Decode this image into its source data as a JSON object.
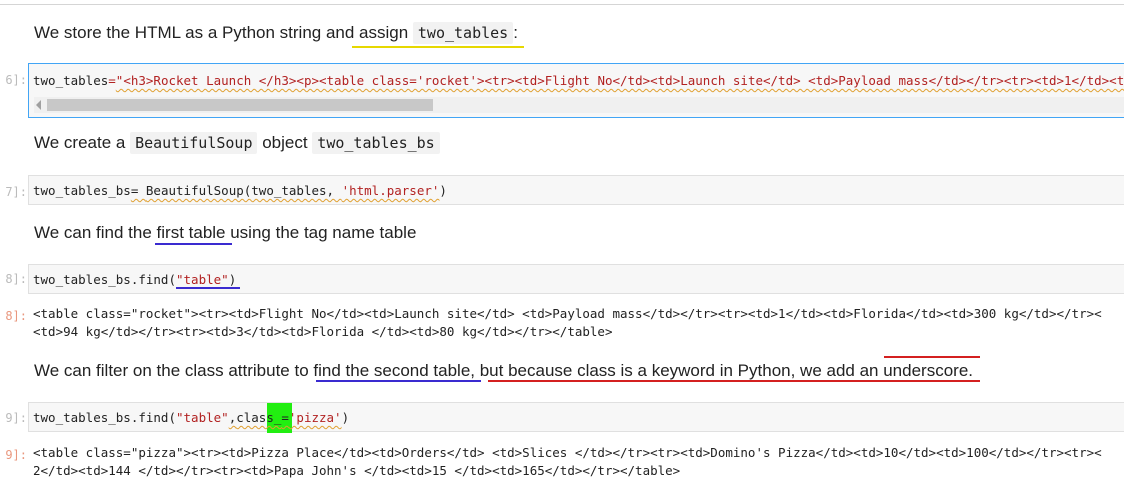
{
  "md1": {
    "text": "We store the HTML as a Python string and assign ",
    "code": "two_tables",
    "tail": ":"
  },
  "cell1": {
    "prompt": "6]:",
    "var": "two_tables",
    "eq": "=",
    "string": "\"<h3>Rocket Launch </h3><p><table class='rocket'><tr><td>Flight No</td><td>Launch site</td> <td>Payload mass</td></tr><tr><td>1</td><t"
  },
  "md2": {
    "pre": "We create a ",
    "code1": "BeautifulSoup",
    "mid": " object ",
    "code2": "two_tables_bs"
  },
  "cell2": {
    "prompt": "7]:",
    "pre": "two_tables_bs",
    "eq": "= ",
    "call": "BeautifulSoup(two_tables, ",
    "str": "'html.parser'",
    "close": ")"
  },
  "md3": {
    "text": "We can find the first table using the tag name table"
  },
  "cell3": {
    "prompt": "8]:",
    "pre": "two_tables_bs.find(",
    "str": "\"table\"",
    "close": ")"
  },
  "out3": {
    "prompt": "8]:",
    "line1": "<table class=\"rocket\"><tr><td>Flight No</td><td>Launch site</td> <td>Payload mass</td></tr><tr><td>1</td><td>Florida</td><td>300 kg</td></tr><",
    "line2": "<td>94 kg</td></tr><tr><td>3</td><td>Florida </td><td>80 kg</td></tr></table>"
  },
  "md4": {
    "text": "We can filter on the class attribute to find the second table, but because class is a keyword in Python, we add an underscore."
  },
  "cell4": {
    "prompt": "9]:",
    "pre": "two_tables_bs.find(",
    "str1": "\"table\"",
    "comma": ",",
    "kw": "class_",
    "eq": "=",
    "str2": "'pizza'",
    "close": ")"
  },
  "out4": {
    "prompt": "9]:",
    "line1": "<table class=\"pizza\"><tr><td>Pizza Place</td><td>Orders</td> <td>Slices </td></tr><tr><td>Domino's Pizza</td><td>10</td><td>100</td></tr><tr><",
    "line2": "2</td><td>144 </td></tr><tr><td>Papa John's </td><td>15 </td><td>165</td></tr></table>"
  },
  "colors": {
    "underline_yellow": "#e6d800",
    "underline_blue": "#3a2bd0",
    "underline_red": "#d42020",
    "highlight_green": "#22ee11"
  }
}
